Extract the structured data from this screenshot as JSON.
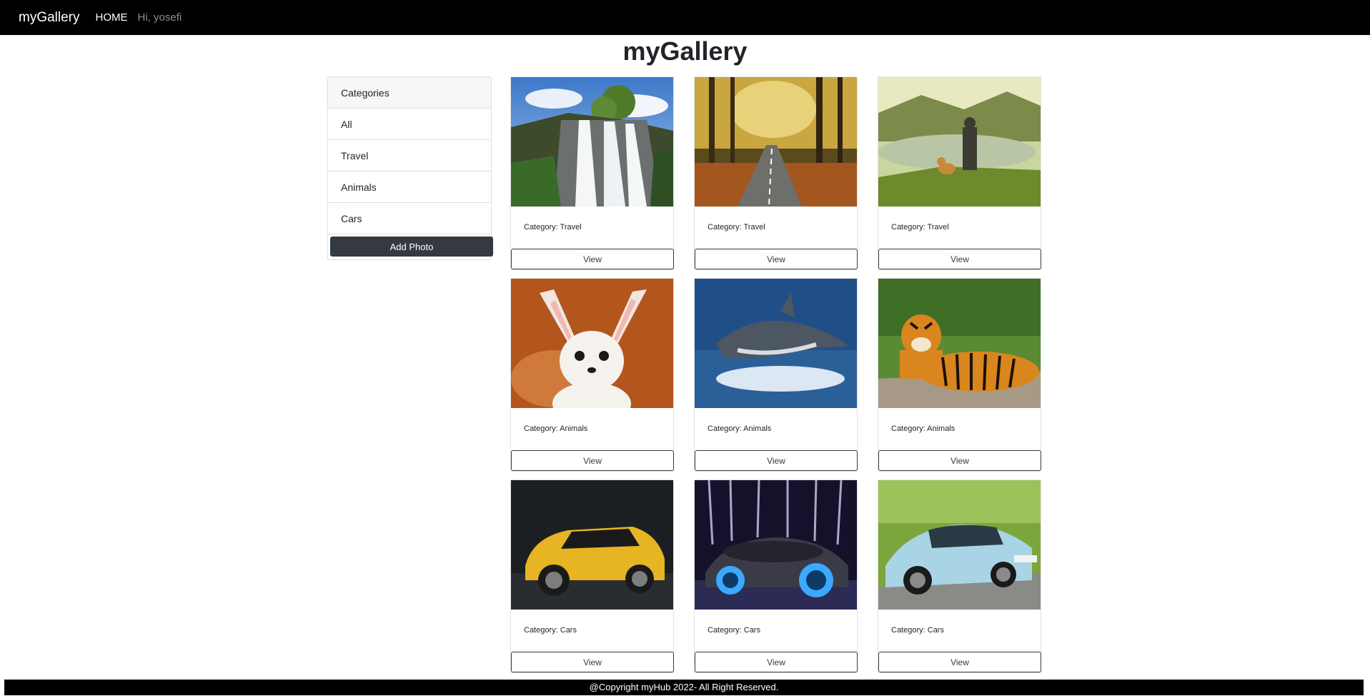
{
  "navbar": {
    "brand": "myGallery",
    "home": "HOME",
    "greeting": "Hi, yosefi"
  },
  "page_title": "myGallery",
  "sidebar": {
    "header": "Categories",
    "items": [
      {
        "label": "All"
      },
      {
        "label": "Travel"
      },
      {
        "label": "Animals"
      },
      {
        "label": "Cars"
      }
    ],
    "add_photo_label": "Add Photo"
  },
  "gallery": {
    "cards": [
      {
        "category": "Category: Travel",
        "image": "waterfall",
        "view_label": "View"
      },
      {
        "category": "Category: Travel",
        "image": "autumn-road",
        "view_label": "View"
      },
      {
        "category": "Category: Travel",
        "image": "hiker-with-dog-lake",
        "view_label": "View"
      },
      {
        "category": "Category: Animals",
        "image": "fennec-fox",
        "view_label": "View"
      },
      {
        "category": "Category: Animals",
        "image": "dolphin",
        "view_label": "View"
      },
      {
        "category": "Category: Animals",
        "image": "tiger",
        "view_label": "View"
      },
      {
        "category": "Category: Cars",
        "image": "yellow-suv",
        "view_label": "View"
      },
      {
        "category": "Category: Cars",
        "image": "concept-car",
        "view_label": "View"
      },
      {
        "category": "Category: Cars",
        "image": "blue-sports-car",
        "view_label": "View"
      }
    ]
  },
  "footer": {
    "text": "@Copyright myHub 2022- All Right Reserved."
  },
  "colors": {
    "navbar_bg": "#000000",
    "button_dark": "#343a40",
    "footer_bg": "#000000"
  }
}
